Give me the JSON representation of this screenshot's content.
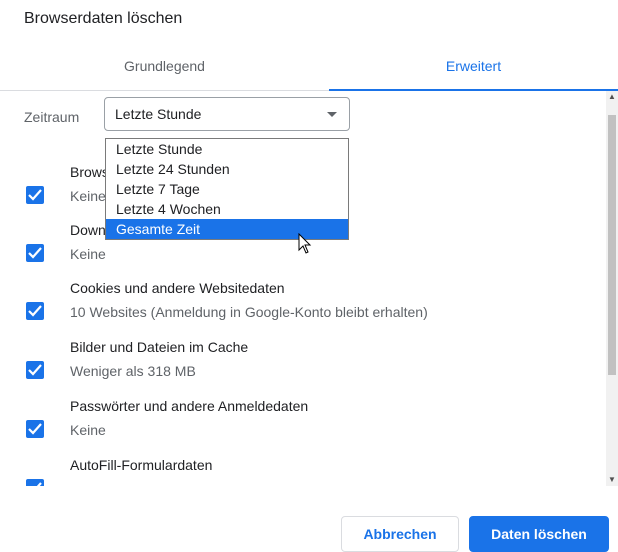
{
  "dialog": {
    "title": "Browserdaten löschen",
    "tabs": [
      {
        "label": "Grundlegend",
        "active": false
      },
      {
        "label": "Erweitert",
        "active": true
      }
    ],
    "time_range": {
      "label": "Zeitraum",
      "selected": "Letzte Stunde",
      "options": [
        "Letzte Stunde",
        "Letzte 24 Stunden",
        "Letzte 7 Tage",
        "Letzte 4 Wochen",
        "Gesamte Zeit"
      ],
      "highlighted": "Gesamte Zeit"
    },
    "items": [
      {
        "title": "Browserverlauf",
        "subtitle": "Keine",
        "checked": true
      },
      {
        "title": "Downloadverlauf",
        "subtitle": "Keine",
        "checked": true
      },
      {
        "title": "Cookies und andere Websitedaten",
        "subtitle": "10 Websites (Anmeldung in Google-Konto bleibt erhalten)",
        "checked": true
      },
      {
        "title": "Bilder und Dateien im Cache",
        "subtitle": "Weniger als 318 MB",
        "checked": true
      },
      {
        "title": "Passwörter und andere Anmeldedaten",
        "subtitle": "Keine",
        "checked": true
      },
      {
        "title": "AutoFill-Formulardaten",
        "subtitle": "",
        "checked": true
      }
    ],
    "buttons": {
      "cancel": "Abbrechen",
      "confirm": "Daten löschen"
    }
  },
  "colors": {
    "accent": "#1a73e8",
    "text": "#202124",
    "secondary_text": "#5f6368",
    "highlight_text": "#ffffff"
  }
}
